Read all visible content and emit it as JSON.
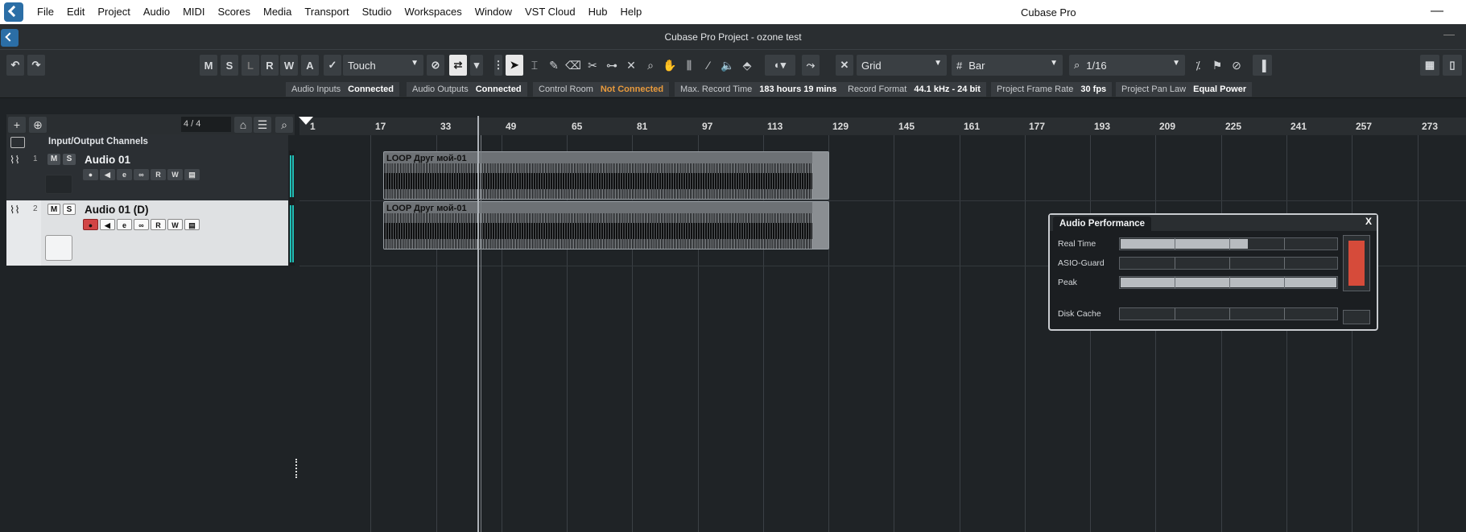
{
  "app": {
    "window_title": "Cubase Pro",
    "project_title": "Cubase Pro Project - ozone test"
  },
  "menu": [
    "File",
    "Edit",
    "Project",
    "Audio",
    "MIDI",
    "Scores",
    "Media",
    "Transport",
    "Studio",
    "Workspaces",
    "Window",
    "VST Cloud",
    "Hub",
    "Help"
  ],
  "toolbar": {
    "m_label": "M",
    "s_label": "S",
    "l_label": "L",
    "r_label": "R",
    "w_label": "W",
    "a_label": "A",
    "automation_mode": "Touch",
    "snap_type": "Grid",
    "grid_type": "Bar",
    "quantize": "1/16"
  },
  "status": {
    "audio_inputs_label": "Audio Inputs",
    "audio_inputs_value": "Connected",
    "audio_outputs_label": "Audio Outputs",
    "audio_outputs_value": "Connected",
    "control_room_label": "Control Room",
    "control_room_value": "Not Connected",
    "max_record_label": "Max. Record Time",
    "max_record_value": "183 hours 19 mins",
    "record_format_label": "Record Format",
    "record_format_value": "44.1 kHz - 24 bit",
    "frame_rate_label": "Project Frame Rate",
    "frame_rate_value": "30 fps",
    "pan_law_label": "Project Pan Law",
    "pan_law_value": "Equal Power"
  },
  "track_list": {
    "signature": "4 / 4",
    "io_channels_label": "Input/Output Channels",
    "tracks": [
      {
        "number": "1",
        "name": "Audio 01"
      },
      {
        "number": "2",
        "name": "Audio 01 (D)"
      }
    ],
    "m_label": "M",
    "s_label": "S",
    "r_label": "R",
    "w_label": "W"
  },
  "ruler": [
    "1",
    "17",
    "33",
    "49",
    "65",
    "81",
    "97",
    "113",
    "129",
    "145",
    "161",
    "177",
    "193",
    "209",
    "225",
    "241",
    "257",
    "273"
  ],
  "clips": [
    {
      "name": "LOOP Друг мой-01"
    },
    {
      "name": "LOOP Друг мой-01"
    }
  ],
  "performance": {
    "title": "Audio Performance",
    "close_label": "X",
    "real_time_label": "Real Time",
    "real_time_level": 0.59,
    "asio_guard_label": "ASIO-Guard",
    "asio_guard_level": 0.0,
    "peak_label": "Peak",
    "peak_level": 1.0,
    "disk_cache_label": "Disk Cache",
    "disk_cache_level": 0.0,
    "overload_color": "#d64b3a"
  }
}
